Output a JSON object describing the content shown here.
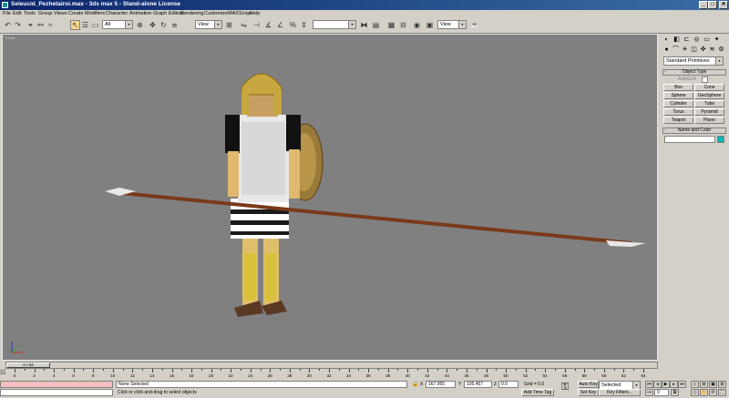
{
  "window": {
    "title": "Seleucid_Pezhetairoi.max - 3ds max 5 - Stand-alone License",
    "minimize": "_",
    "maximize": "□",
    "close": "✕"
  },
  "menu": [
    "File",
    "Edit",
    "Tools",
    "Group",
    "Views",
    "Create",
    "Modifiers",
    "Character",
    "Animation",
    "Graph Editors",
    "Rendering",
    "Customize",
    "MAXScript",
    "Help"
  ],
  "toolbar": {
    "selection_filter": "All",
    "reference_coord": "View",
    "named_selection": "",
    "render_type": "View",
    "arrow": "▾"
  },
  "viewport": {
    "label": "Persp"
  },
  "command_panel": {
    "category_dropdown": "Standard Primitives",
    "object_type_title": "Object Type",
    "autogrid": "AutoGrid",
    "buttons": [
      "Box",
      "Cone",
      "Sphere",
      "GeoSphere",
      "Cylinder",
      "Tube",
      "Torus",
      "Pyramid",
      "Teapot",
      "Plane"
    ],
    "name_color_title": "Name and Color",
    "name_value": "",
    "collapse": "-",
    "accent_color": "#00b4b4"
  },
  "timeline": {
    "slider_label": "0 / 64",
    "ticks": [
      "0",
      "2",
      "4",
      "6",
      "8",
      "10",
      "12",
      "14",
      "16",
      "18",
      "20",
      "22",
      "24",
      "26",
      "28",
      "30",
      "32",
      "34",
      "36",
      "38",
      "40",
      "42",
      "44",
      "46",
      "48",
      "50",
      "52",
      "54",
      "56",
      "58",
      "60",
      "62",
      "64"
    ]
  },
  "status": {
    "selection": "None Selected",
    "prompt": "Click or click-and-drag to select objects",
    "x_label": "X",
    "x_value": "167.955",
    "y_label": "Y",
    "y_value": "105.457",
    "z_label": "Z",
    "z_value": "0.0",
    "grid": "Grid = 0.0",
    "add_time_tag": "Add Time Tag",
    "auto_key": "Auto Key",
    "set_key": "Set Key",
    "key_mode": "Selected",
    "key_filters": "Key Filters...",
    "frame": "0"
  }
}
